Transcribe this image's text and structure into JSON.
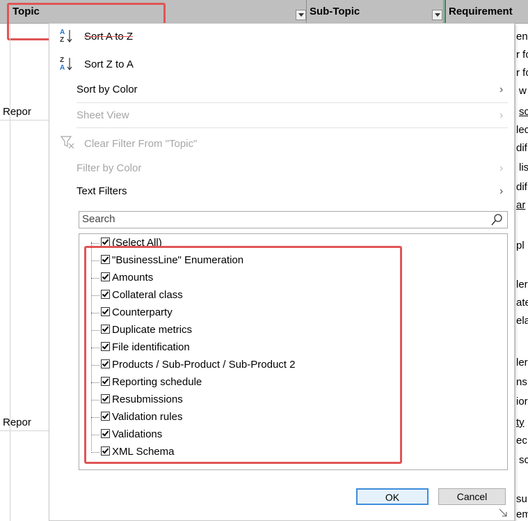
{
  "header": {
    "topic": "Topic",
    "sub_topic": "Sub-Topic",
    "requirement": "Requirement"
  },
  "background": {
    "left_fragments": [
      "Repor",
      "Repor"
    ],
    "right_fragments": [
      "ent",
      "r fo",
      "r fo",
      "w",
      "sc",
      "lec",
      "dif",
      "lis",
      "dif",
      "ar",
      "pl",
      "ler",
      "ate",
      "ela",
      "ler",
      "ns ,",
      "ior",
      "ty",
      "ec",
      "sc",
      "su",
      "em"
    ]
  },
  "menu": {
    "sort_az": "Sort A to Z",
    "sort_za": "Sort Z to A",
    "sort_by_color": "Sort by Color",
    "sheet_view": "Sheet View",
    "clear_filter": "Clear Filter From \"Topic\"",
    "filter_by_color": "Filter by Color",
    "text_filters": "Text Filters",
    "search_placeholder": "Search",
    "items": [
      "(Select All)",
      "\"BusinessLine\" Enumeration",
      "Amounts",
      "Collateral class",
      "Counterparty",
      "Duplicate metrics",
      "File identification",
      "Products / Sub-Product / Sub-Product 2",
      "Reporting schedule",
      "Resubmissions",
      "Validation rules",
      "Validations",
      "XML Schema"
    ],
    "ok": "OK",
    "cancel": "Cancel"
  },
  "colors": {
    "highlight": "#e05555",
    "header_bg": "#bfbfbf",
    "ok_border": "#3c8ddc"
  }
}
